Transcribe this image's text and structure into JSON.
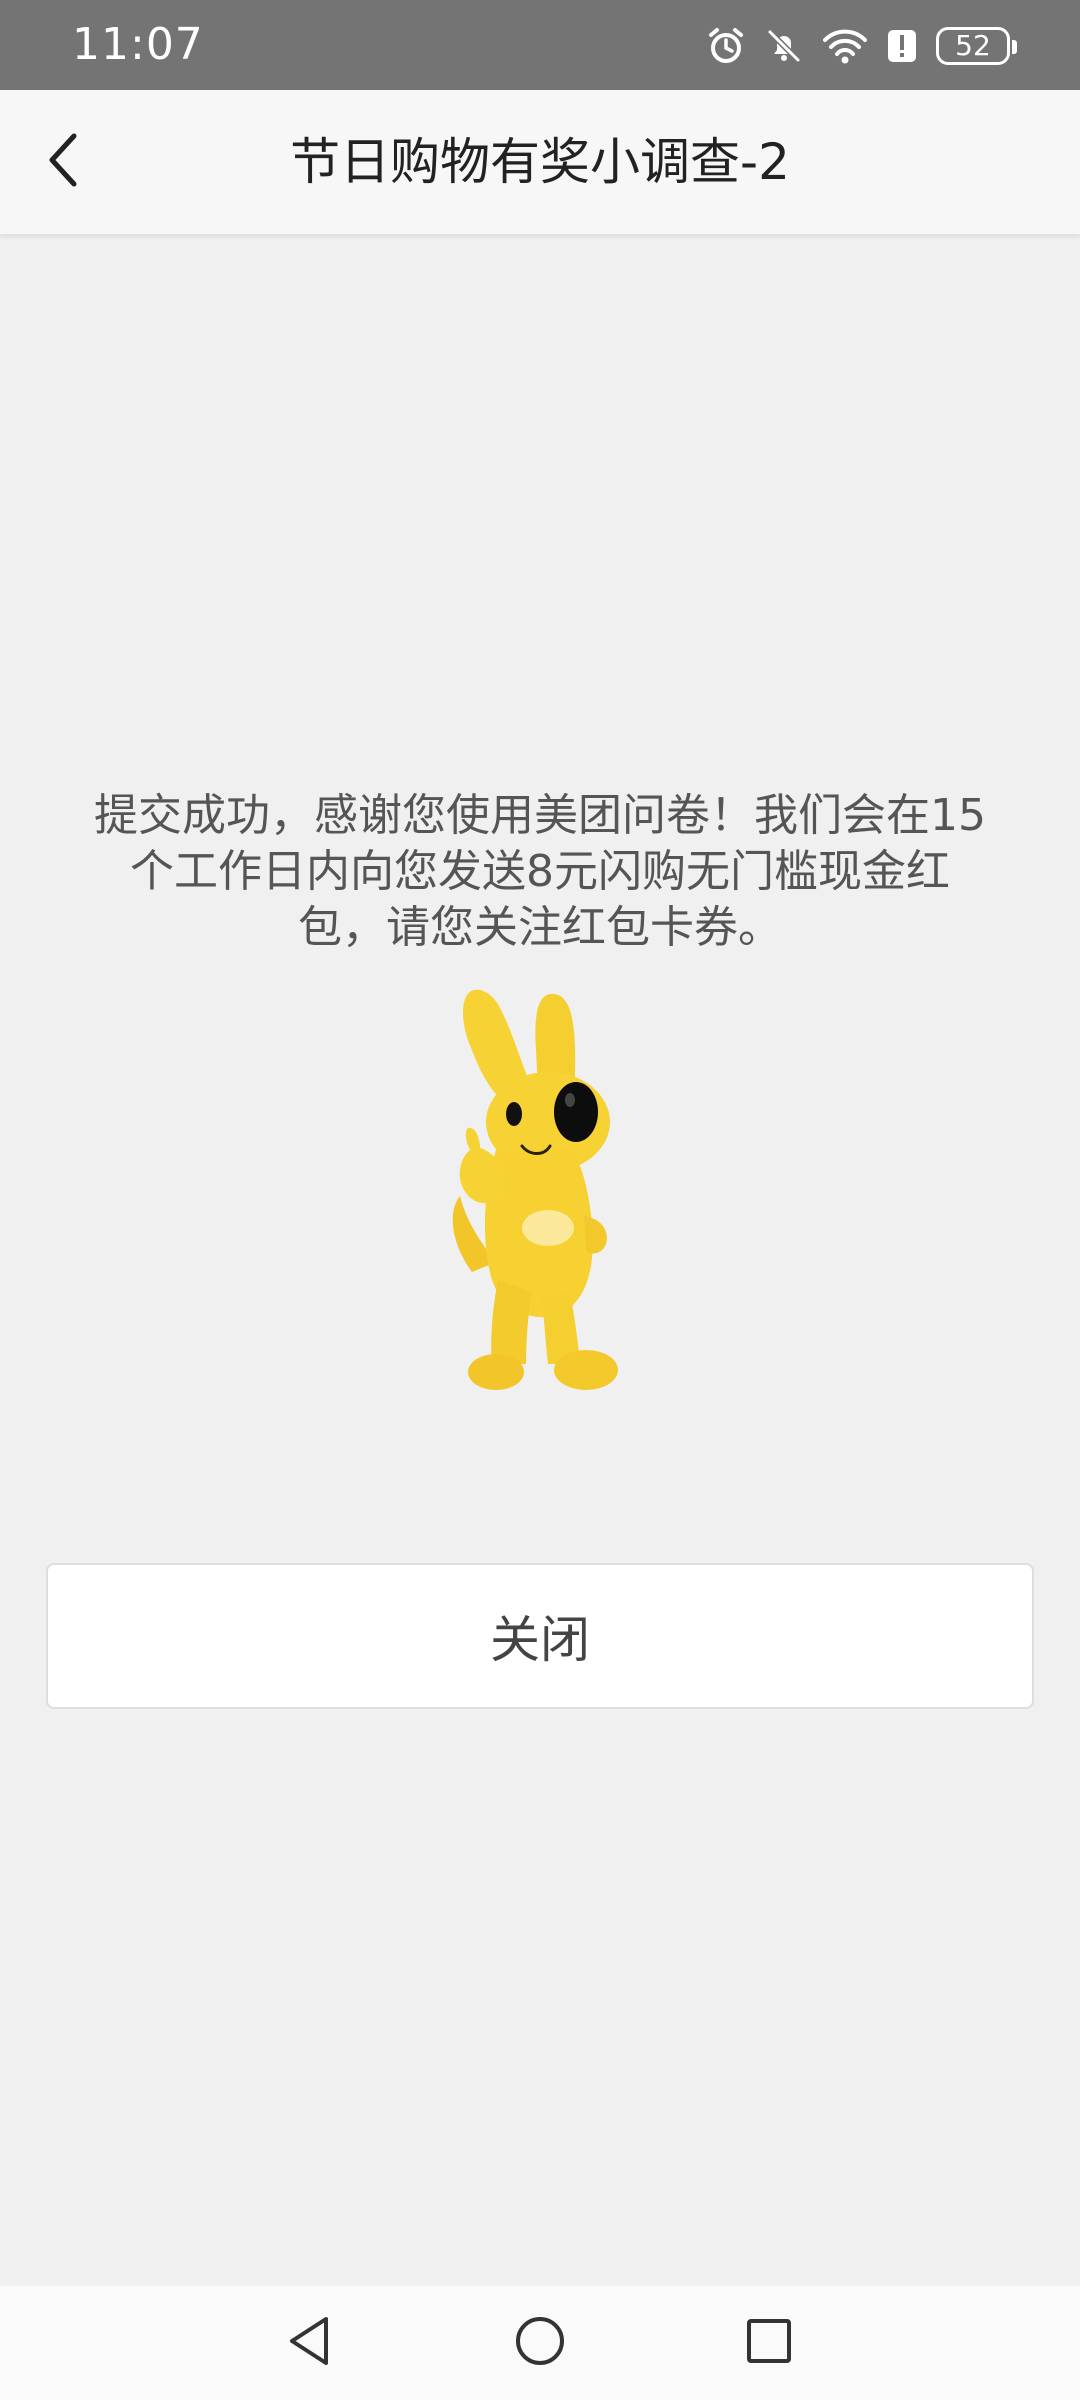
{
  "status_bar": {
    "time": "11:07",
    "battery": "52",
    "icons": [
      "alarm-icon",
      "notifications-off-icon",
      "wifi-icon",
      "alert-icon",
      "battery-icon"
    ]
  },
  "header": {
    "title": "节日购物有奖小调查-2",
    "back_icon": "chevron-left-icon"
  },
  "main": {
    "message": "提交成功，感谢您使用美团问卷！我们会在15个工作日内向您发送8元闪购无门槛现金红包，请您关注红包卡券。",
    "mascot": "yellow-kangaroo-mascot",
    "close_label": "关闭"
  },
  "nav_bar": {
    "icons": [
      "back-triangle-icon",
      "home-circle-icon",
      "recents-square-icon"
    ]
  },
  "colors": {
    "status_bar": "#747474",
    "background": "#f0f0f0",
    "mascot_yellow": "#f7d234"
  }
}
